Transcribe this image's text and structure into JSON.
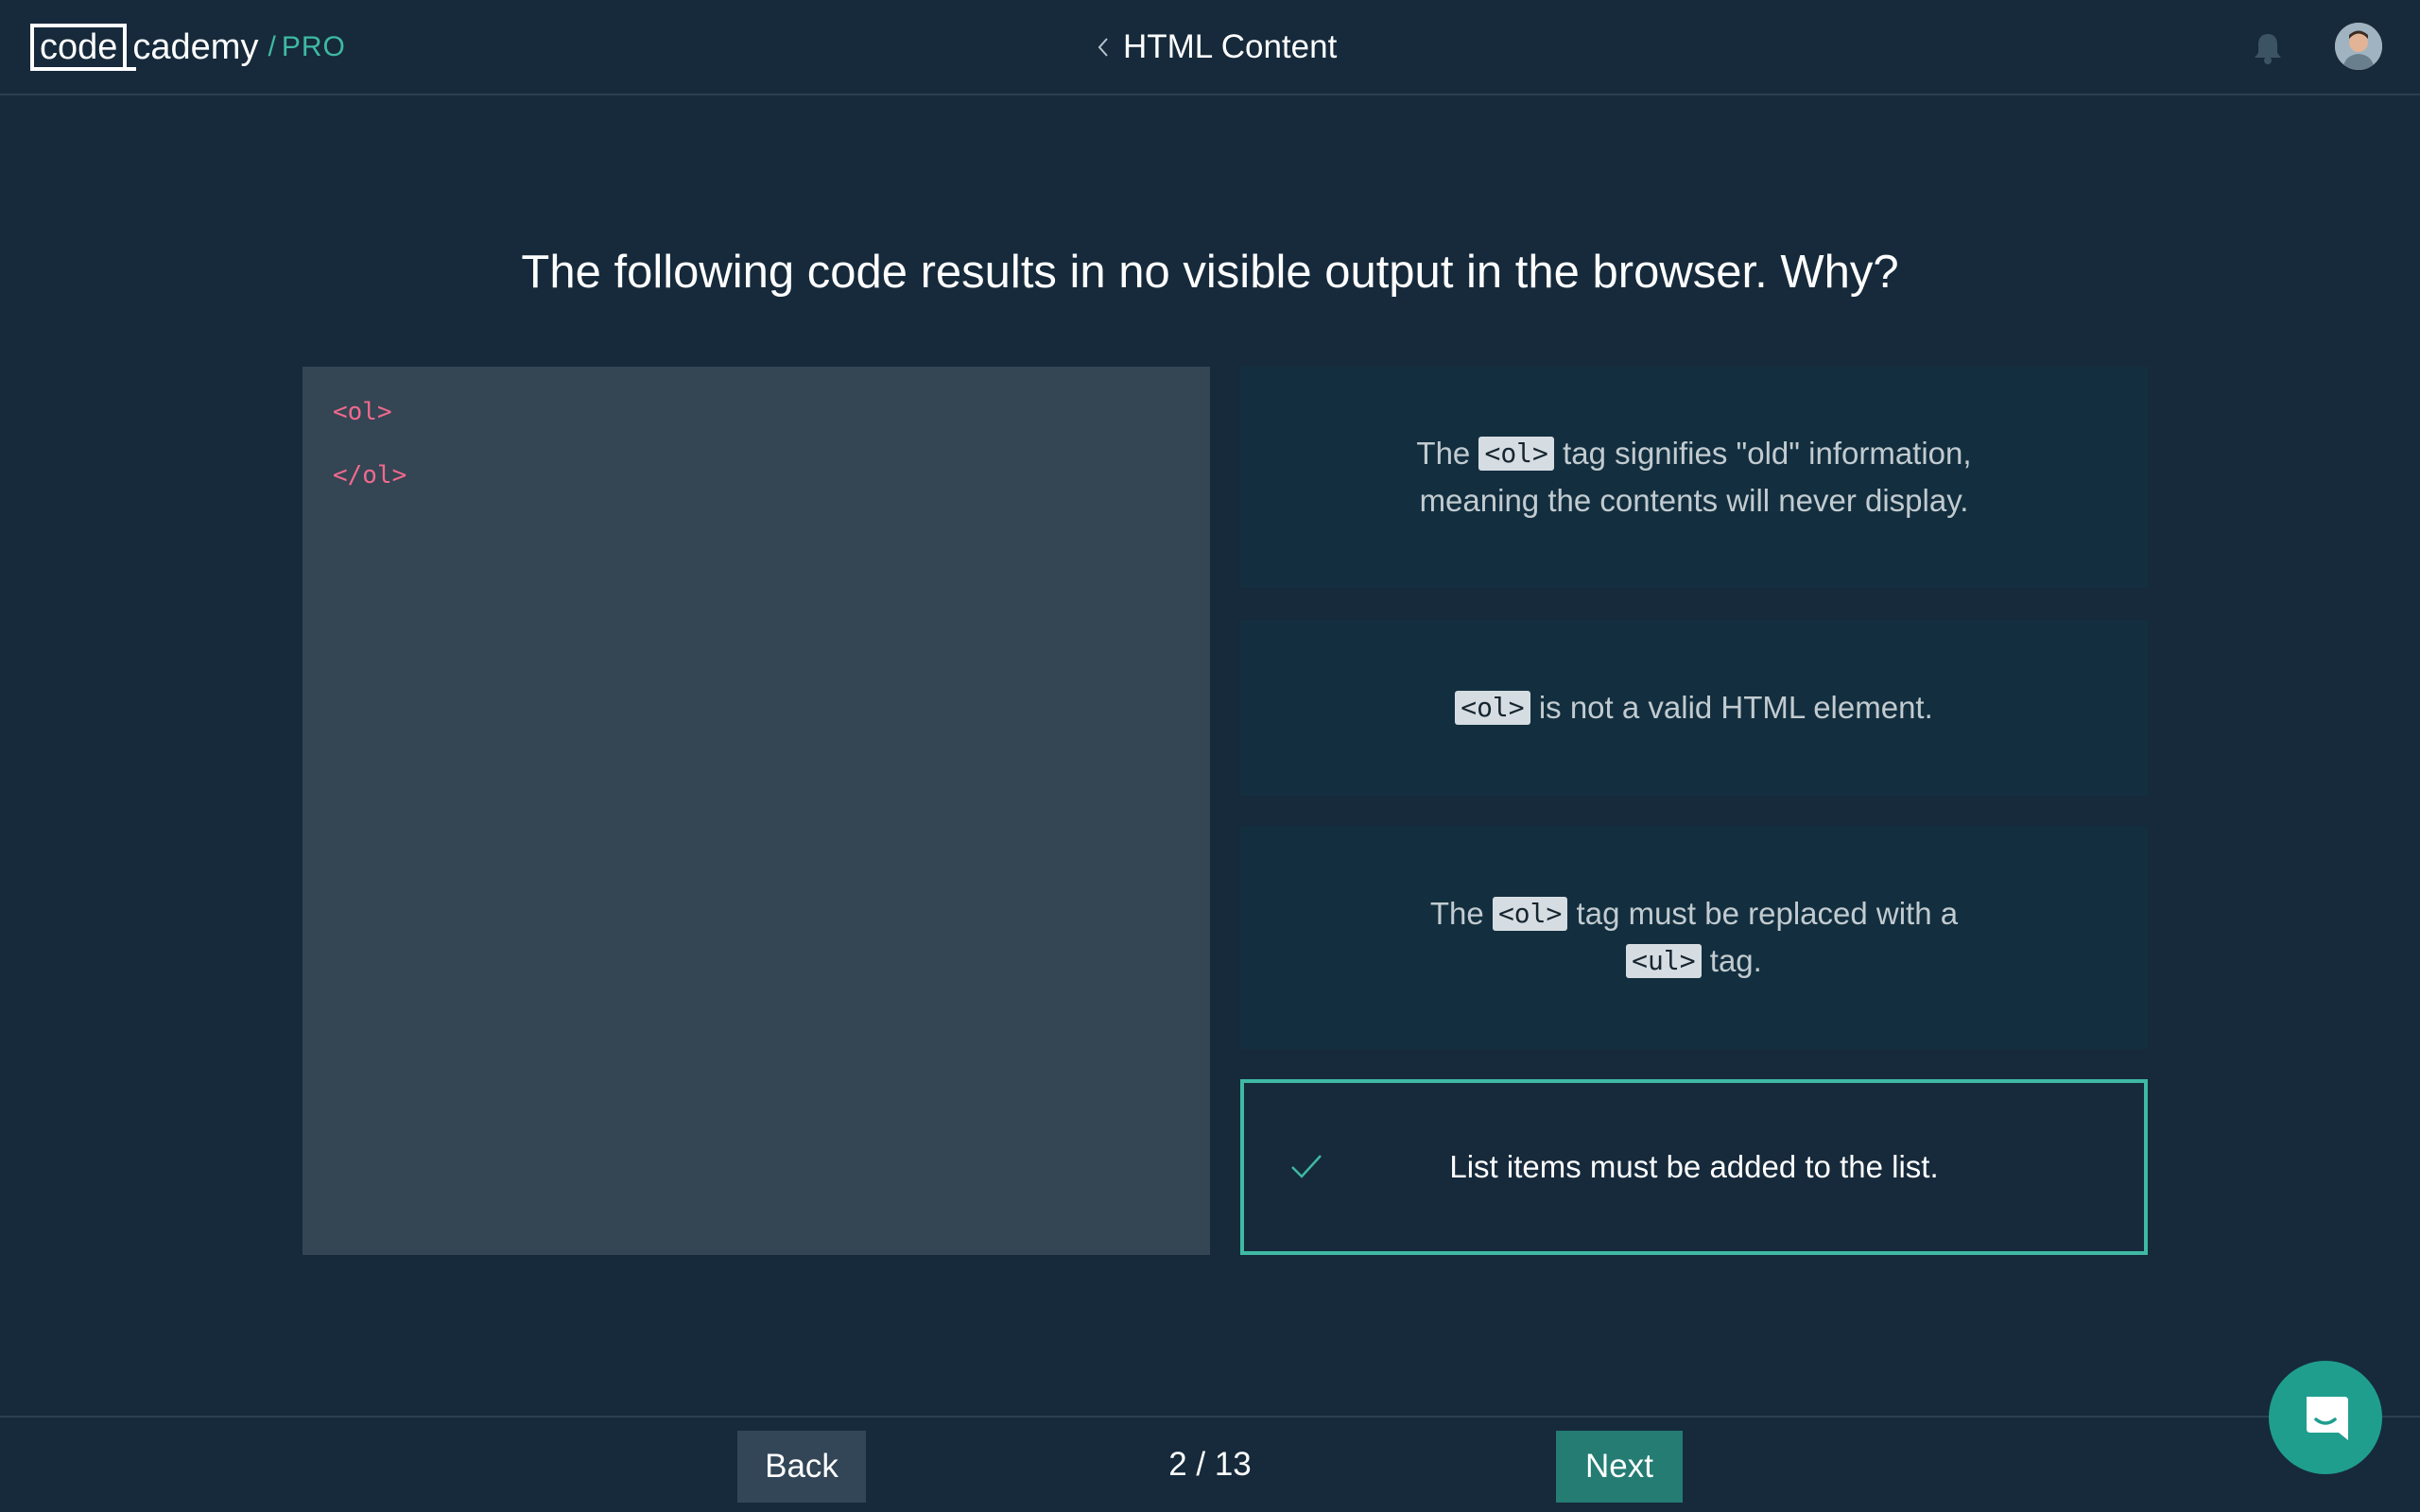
{
  "header": {
    "logo": {
      "box_text": "code",
      "rest_text": "cademy",
      "slash": "/",
      "pro": "PRO"
    },
    "course_title": "HTML Content",
    "back_icon": "chevron-left-icon",
    "notification_icon": "bell-icon",
    "avatar_icon": "user-avatar"
  },
  "question": {
    "text": "The following code results in no visible output in the browser. Why?"
  },
  "code_panel": {
    "lines": [
      "<ol>",
      "</ol>"
    ]
  },
  "answers": [
    {
      "before": "The ",
      "tag": "<ol>",
      "after": " tag signifies \"old\" information, meaning the contents will never display.",
      "selected": false
    },
    {
      "before": "",
      "tag": "<ol>",
      "after": " is not a valid HTML element.",
      "selected": false
    },
    {
      "before": "The ",
      "tag": "<ol>",
      "middle": " tag must be replaced with a ",
      "tag2": "<ul>",
      "after": " tag.",
      "selected": false
    },
    {
      "text": "List items must be added to the list.",
      "selected": true,
      "icon": "checkmark-icon"
    }
  ],
  "footer": {
    "back_label": "Back",
    "next_label": "Next",
    "progress": "2 / 13"
  },
  "chat_icon": "chat-icon",
  "colors": {
    "background": "#162a3b",
    "accent": "#3fb9a3",
    "answer_bg": "#132f3f",
    "code_bg": "#344554",
    "code_text": "#ef6a8c",
    "next_button": "#247c73"
  }
}
